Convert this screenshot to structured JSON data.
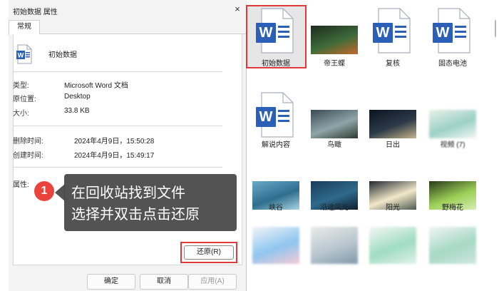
{
  "dialog": {
    "title": "初始数据 属性",
    "close_glyph": "×",
    "tab": "常规",
    "file_name": "初始数据",
    "type_label": "类型:",
    "type_value": "Microsoft Word 文档",
    "location_label": "原位置:",
    "location_value": "Desktop",
    "size_label": "大小:",
    "size_value": "33.8 KB",
    "deleted_label": "删除时间:",
    "deleted_value": "2024年4月9日，15:50:28",
    "created_label": "创建时间:",
    "created_value": "2024年4月9日，15:49:17",
    "attributes_label": "属性:",
    "restore_button": "还原(R)",
    "ok_button": "确定",
    "cancel_button": "取消",
    "apply_button": "应用(A)"
  },
  "tooltip": {
    "step": "1",
    "line1": "在回收站找到文件",
    "line2": "选择并双击点击还原"
  },
  "explorer": {
    "items": [
      {
        "name": "初始数据",
        "kind": "word-doc"
      },
      {
        "name": "帝王蝶",
        "kind": "image"
      },
      {
        "name": "复核",
        "kind": "word-doc"
      },
      {
        "name": "固态电池",
        "kind": "word-doc"
      },
      {
        "name": "解说内容",
        "kind": "word-doc"
      },
      {
        "name": "鸟瞰",
        "kind": "image"
      },
      {
        "name": "日出",
        "kind": "image"
      },
      {
        "name": "视频 (7)",
        "kind": "image"
      },
      {
        "name": "峡谷",
        "kind": "image"
      },
      {
        "name": "沿途风光",
        "kind": "image"
      },
      {
        "name": "阳光",
        "kind": "image"
      },
      {
        "name": "野梅花",
        "kind": "image"
      },
      {
        "name": "",
        "kind": "image"
      },
      {
        "name": "",
        "kind": "image"
      },
      {
        "name": "",
        "kind": "image"
      },
      {
        "name": "",
        "kind": "image"
      }
    ]
  },
  "colors": {
    "highlight_red": "#e23a3a",
    "word_blue": "#2b5fb8",
    "badge_red": "#e8443c"
  }
}
